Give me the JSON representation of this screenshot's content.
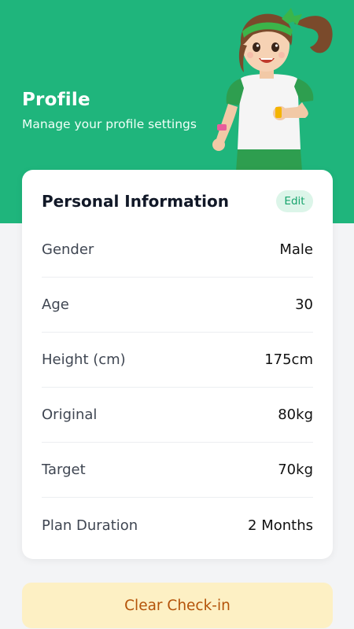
{
  "header": {
    "title": "Profile",
    "subtitle": "Manage your profile settings"
  },
  "card": {
    "title": "Personal Information",
    "edit_label": "Edit",
    "rows": [
      {
        "label": "Gender",
        "value": "Male"
      },
      {
        "label": "Age",
        "value": "30"
      },
      {
        "label": "Height (cm)",
        "value": "175cm"
      },
      {
        "label": "Original",
        "value": "80kg"
      },
      {
        "label": "Target",
        "value": "70kg"
      },
      {
        "label": "Plan Duration",
        "value": "2 Months"
      }
    ]
  },
  "actions": {
    "clear_label": "Clear Check-in"
  },
  "colors": {
    "brand_green": "#1fb57c",
    "edit_bg": "#dcf5e9",
    "clear_bg": "#fdf0c4",
    "clear_text": "#b45309"
  },
  "mascot": {
    "icon": "running-girl-illustration"
  }
}
